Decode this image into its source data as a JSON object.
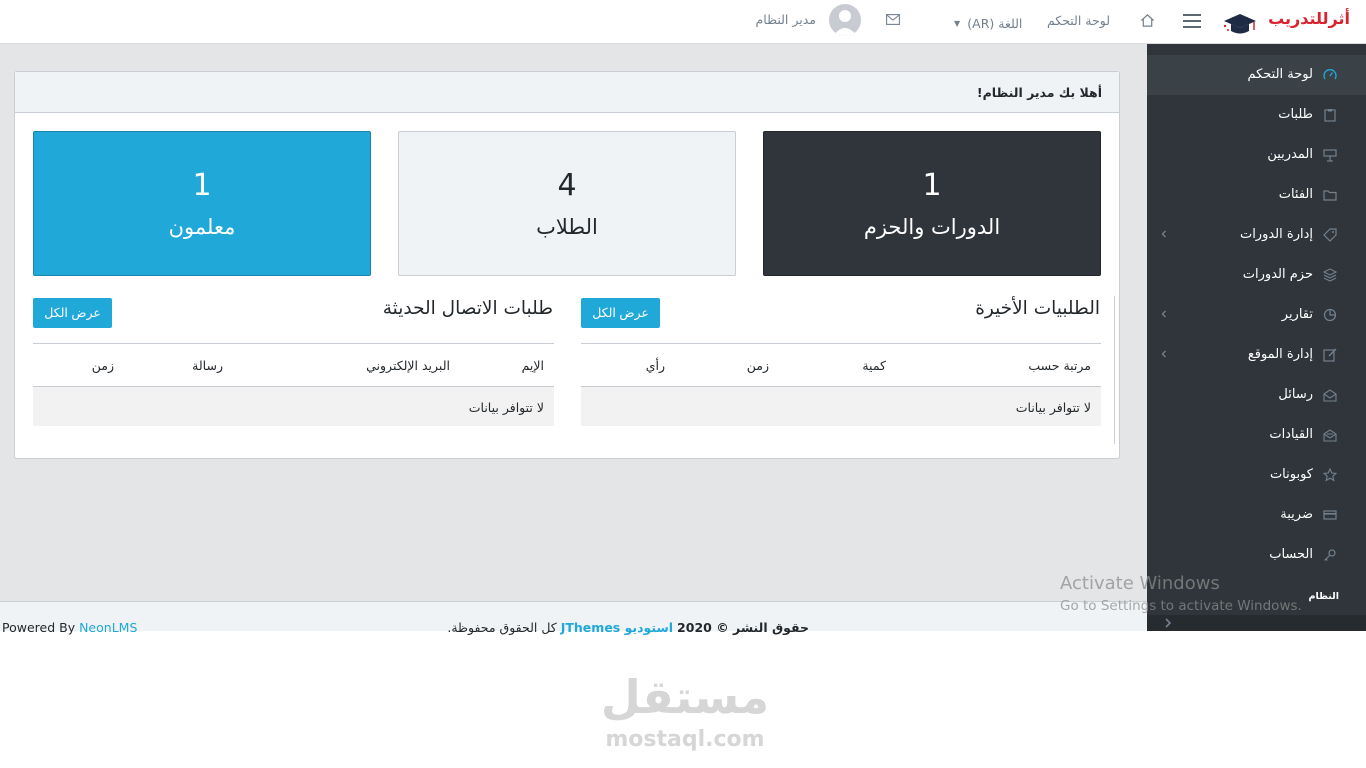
{
  "header": {
    "logo_text": "أثرللتدريب",
    "menu_icon": "hamburger-icon",
    "home_icon": "home-icon",
    "dashboard_link": "لوحة التحكم",
    "language": "اللغة (AR)",
    "mail_icon": "envelope-icon",
    "user_name": "مدير النظام"
  },
  "welcome": "أهلا بك مدير النظام!",
  "stats": {
    "courses": {
      "value": "1",
      "label": "الدورات والحزم"
    },
    "students": {
      "value": "4",
      "label": "الطلاب"
    },
    "teachers": {
      "value": "1",
      "label": "معلمون"
    }
  },
  "recent_orders": {
    "title": "الطلبيات الأخيرة",
    "view_all": "عرض الكل",
    "columns": [
      "مرتبة حسب",
      "كمية",
      "زمن",
      "رأي"
    ],
    "empty": "لا تتوافر بيانات"
  },
  "recent_contacts": {
    "title": "طلبات الاتصال الحديثة",
    "view_all": "عرض الكل",
    "columns": [
      "الإيم",
      "البريد الإلكتروني",
      "رسالة",
      "زمن"
    ],
    "empty": "لا تتوافر بيانات"
  },
  "sidebar": {
    "items": [
      {
        "label": "لوحة التحكم",
        "icon": "speedometer-icon",
        "active": true
      },
      {
        "label": "طلبات",
        "icon": "clipboard-icon"
      },
      {
        "label": "المدربين",
        "icon": "presenter-icon"
      },
      {
        "label": "الفئات",
        "icon": "folder-icon"
      },
      {
        "label": "إدارة الدورات",
        "icon": "tag-icon",
        "chevron": true
      },
      {
        "label": "حزم الدورات",
        "icon": "layers-icon"
      },
      {
        "label": "تقارير",
        "icon": "pie-chart-icon",
        "chevron": true
      },
      {
        "label": "إدارة الموقع",
        "icon": "edit-icon",
        "chevron": true
      },
      {
        "label": "رسائل",
        "icon": "envelope-open-icon"
      },
      {
        "label": "القيادات",
        "icon": "inbox-icon"
      },
      {
        "label": "كوبونات",
        "icon": "star-icon"
      },
      {
        "label": "ضريبة",
        "icon": "credit-card-icon"
      },
      {
        "label": "الحساب",
        "icon": "key-icon"
      }
    ],
    "section": "النظام",
    "toggle_icon": "chevron-right-icon"
  },
  "footer": {
    "powered_prefix": "Powered By",
    "powered_link": "NeonLMS",
    "copy_prefix": "حقوق النشر © 2020",
    "copy_company": "استوديو JThemes",
    "copy_suffix": "كل الحقوق محفوظة."
  },
  "watermark": {
    "activate_title": "Activate Windows",
    "activate_sub": "Go to Settings to activate Windows.",
    "mostaql_ar": "مستقل",
    "mostaql_en": "mostaql.com"
  }
}
